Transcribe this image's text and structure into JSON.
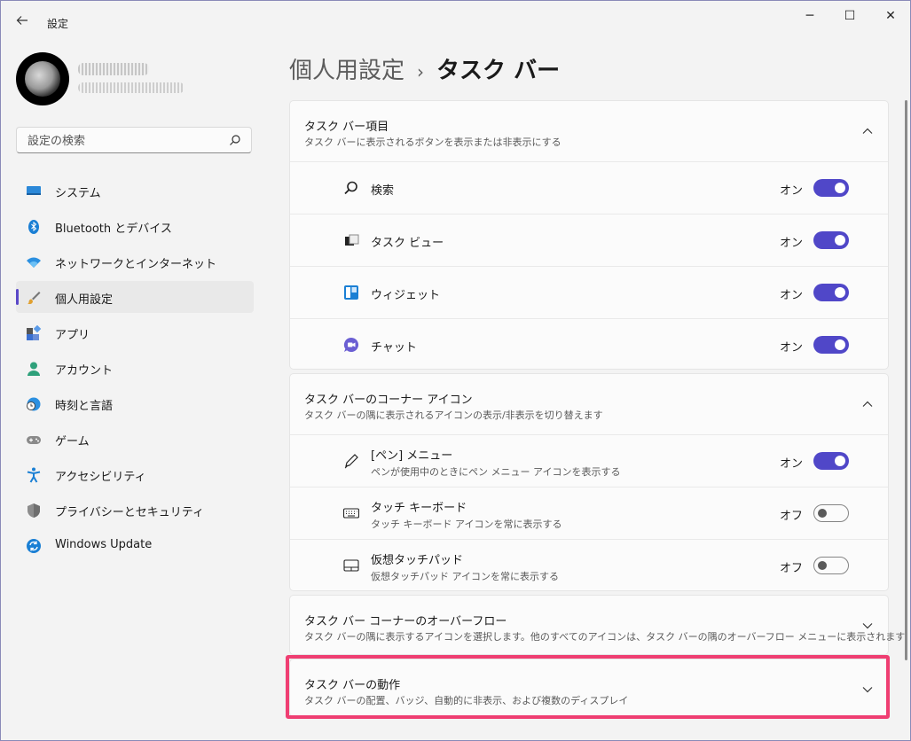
{
  "window": {
    "title": "設定",
    "back_icon": "arrow-left-icon",
    "minimize": "─",
    "maximize": "☐",
    "close": "✕"
  },
  "search": {
    "placeholder": "設定の検索"
  },
  "sidebar": {
    "items": [
      {
        "label": "システム",
        "icon": "display-icon",
        "active": false
      },
      {
        "label": "Bluetooth とデバイス",
        "icon": "bluetooth-icon",
        "active": false
      },
      {
        "label": "ネットワークとインターネット",
        "icon": "wifi-icon",
        "active": false
      },
      {
        "label": "個人用設定",
        "icon": "brush-icon",
        "active": true
      },
      {
        "label": "アプリ",
        "icon": "apps-icon",
        "active": false
      },
      {
        "label": "アカウント",
        "icon": "account-icon",
        "active": false
      },
      {
        "label": "時刻と言語",
        "icon": "globe-clock-icon",
        "active": false
      },
      {
        "label": "ゲーム",
        "icon": "gamepad-icon",
        "active": false
      },
      {
        "label": "アクセシビリティ",
        "icon": "accessibility-icon",
        "active": false
      },
      {
        "label": "プライバシーとセキュリティ",
        "icon": "shield-icon",
        "active": false
      },
      {
        "label": "Windows Update",
        "icon": "update-icon",
        "active": false
      }
    ]
  },
  "breadcrumb": {
    "parent": "個人用設定",
    "separator": "›",
    "current": "タスク バー"
  },
  "sections": {
    "items": {
      "title": "タスク バー項目",
      "subtitle": "タスク バーに表示されるボタンを表示または非表示にする",
      "rows": [
        {
          "label": "検索",
          "state": "オン",
          "on": true
        },
        {
          "label": "タスク ビュー",
          "state": "オン",
          "on": true
        },
        {
          "label": "ウィジェット",
          "state": "オン",
          "on": true
        },
        {
          "label": "チャット",
          "state": "オン",
          "on": true
        }
      ]
    },
    "corner": {
      "title": "タスク バーのコーナー アイコン",
      "subtitle": "タスク バーの隅に表示されるアイコンの表示/非表示を切り替えます",
      "rows": [
        {
          "label": "[ペン] メニュー",
          "sub": "ペンが使用中のときにペン メニュー アイコンを表示する",
          "state": "オン",
          "on": true
        },
        {
          "label": "タッチ キーボード",
          "sub": "タッチ キーボード アイコンを常に表示する",
          "state": "オフ",
          "on": false
        },
        {
          "label": "仮想タッチパッド",
          "sub": "仮想タッチパッド アイコンを常に表示する",
          "state": "オフ",
          "on": false
        }
      ]
    },
    "overflow": {
      "title": "タスク バー コーナーのオーバーフロー",
      "subtitle": "タスク バーの隅に表示するアイコンを選択します。他のすべてのアイコンは、タスク バーの隅のオーバーフロー メニューに表示されます"
    },
    "behavior": {
      "title": "タスク バーの動作",
      "subtitle": "タスク バーの配置、バッジ、自動的に非表示、および複数のディスプレイ"
    }
  },
  "colors": {
    "accent": "#5047c8",
    "highlight": "#ef3e72"
  }
}
